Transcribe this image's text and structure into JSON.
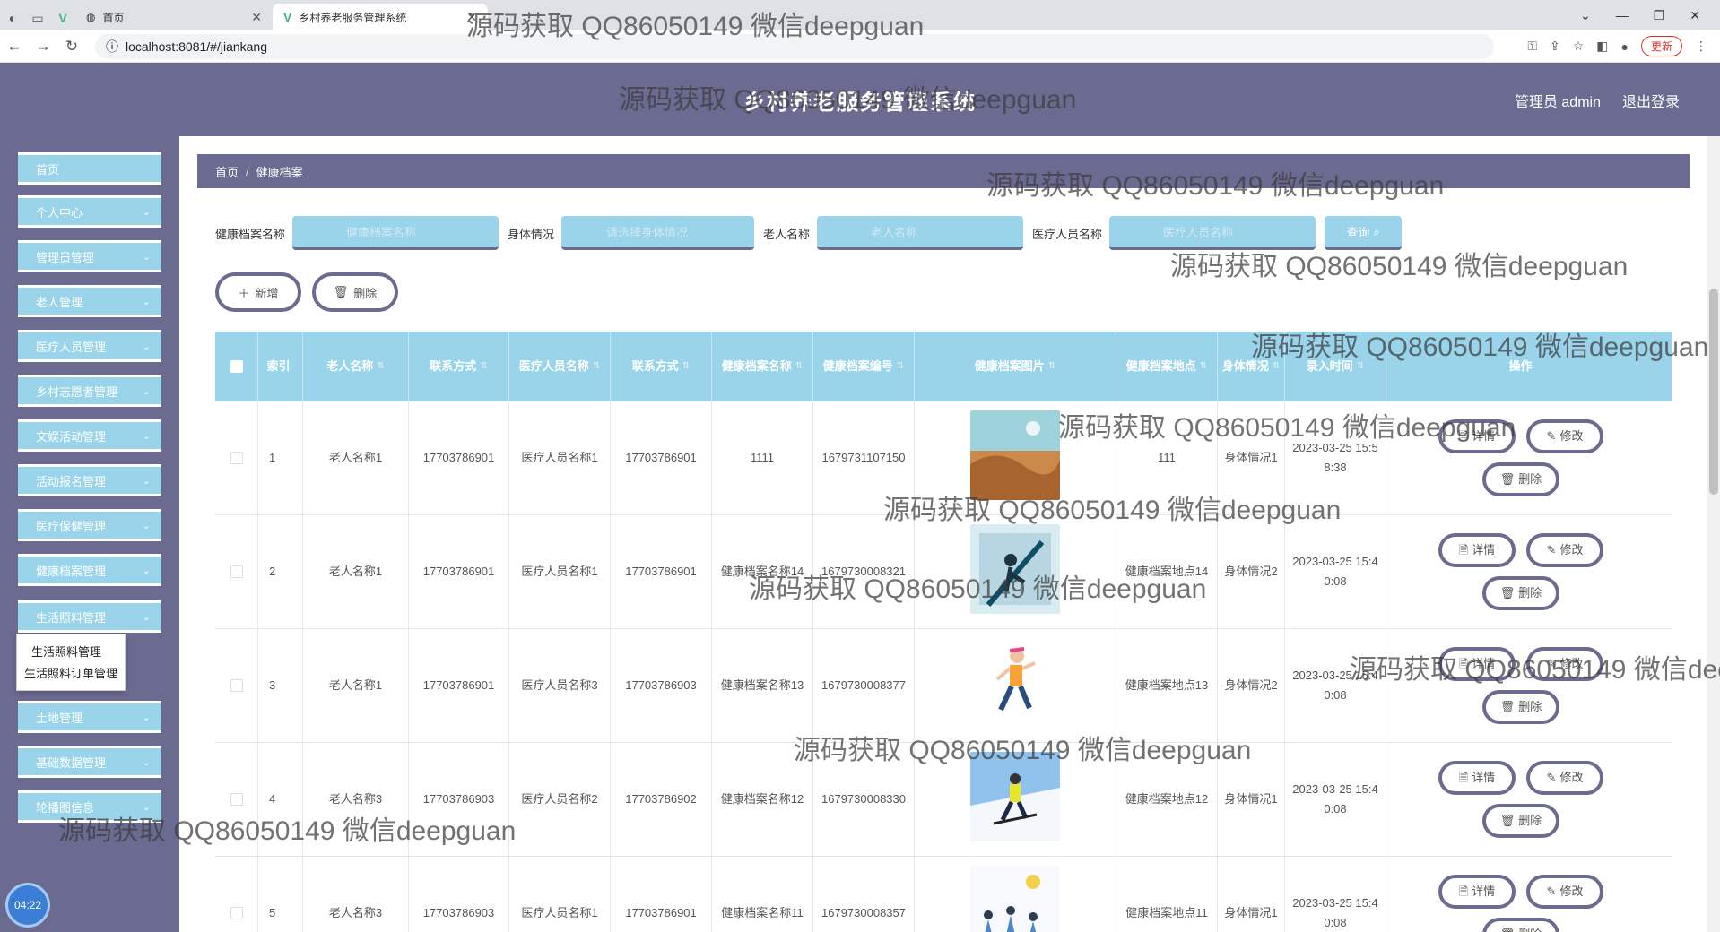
{
  "browser": {
    "tabs": [
      {
        "label": "首页",
        "active": false
      },
      {
        "label": "乡村养老服务管理系统",
        "active": true
      }
    ],
    "url": "localhost:8081/#/jiankang",
    "update_label": "更新"
  },
  "header": {
    "title": "乡村养老服务管理系统",
    "user_label": "管理员 admin",
    "logout_label": "退出登录"
  },
  "sidebar": {
    "items": [
      {
        "label": "首页",
        "expandable": false
      },
      {
        "label": "个人中心",
        "expandable": true
      },
      {
        "label": "管理员管理",
        "expandable": true
      },
      {
        "label": "老人管理",
        "expandable": true
      },
      {
        "label": "医疗人员管理",
        "expandable": true
      },
      {
        "label": "乡村志愿者管理",
        "expandable": true
      },
      {
        "label": "文娱活动管理",
        "expandable": true
      },
      {
        "label": "活动报名管理",
        "expandable": true
      },
      {
        "label": "医疗保健管理",
        "expandable": true
      },
      {
        "label": "健康档案管理",
        "expandable": true
      },
      {
        "label": "生活照料管理",
        "expandable": true
      },
      {
        "label": "土地管理",
        "expandable": true
      },
      {
        "label": "基础数据管理",
        "expandable": true
      },
      {
        "label": "轮播图信息",
        "expandable": true
      }
    ],
    "submenu": [
      "生活照料管理",
      "生活照料订单管理"
    ],
    "timer": "04:22"
  },
  "breadcrumb": {
    "home": "首页",
    "current": "健康档案"
  },
  "search": {
    "fields": [
      {
        "label": "健康档案名称",
        "placeholder": "健康档案名称"
      },
      {
        "label": "身体情况",
        "placeholder": "请选择身体情况"
      },
      {
        "label": "老人名称",
        "placeholder": "老人名称"
      },
      {
        "label": "医疗人员名称",
        "placeholder": "医疗人员名称"
      }
    ],
    "button": "查询"
  },
  "actions": {
    "add": "新增",
    "delete": "删除"
  },
  "table": {
    "headers": [
      "索引",
      "老人名称",
      "联系方式",
      "医疗人员名称",
      "联系方式",
      "健康档案名称",
      "健康档案编号",
      "健康档案图片",
      "健康档案地点",
      "身体情况",
      "录入时间",
      "操作"
    ],
    "rows": [
      {
        "index": "1",
        "elder": "老人名称1",
        "phone1": "17703786901",
        "staff": "医疗人员名称1",
        "phone2": "17703786901",
        "name": "1111",
        "code": "1679731107150",
        "location": "111",
        "status": "身体情况1",
        "time": "2023-03-25 15:58:38",
        "img": "desert"
      },
      {
        "index": "2",
        "elder": "老人名称1",
        "phone1": "17703786901",
        "staff": "医疗人员名称1",
        "phone2": "17703786901",
        "name": "健康档案名称14",
        "code": "1679730008321",
        "location": "健康档案地点14",
        "status": "身体情况2",
        "time": "2023-03-25 15:40:08",
        "img": "treadmill"
      },
      {
        "index": "3",
        "elder": "老人名称1",
        "phone1": "17703786901",
        "staff": "医疗人员名称3",
        "phone2": "17703786903",
        "name": "健康档案名称13",
        "code": "1679730008377",
        "location": "健康档案地点13",
        "status": "身体情况2",
        "time": "2023-03-25 15:40:08",
        "img": "runner"
      },
      {
        "index": "4",
        "elder": "老人名称3",
        "phone1": "17703786903",
        "staff": "医疗人员名称2",
        "phone2": "17703786902",
        "name": "健康档案名称12",
        "code": "1679730008330",
        "location": "健康档案地点12",
        "status": "身体情况1",
        "time": "2023-03-25 15:40:08",
        "img": "skier"
      },
      {
        "index": "5",
        "elder": "老人名称3",
        "phone1": "17703786903",
        "staff": "医疗人员名称1",
        "phone2": "17703786901",
        "name": "健康档案名称11",
        "code": "1679730008357",
        "location": "健康档案地点11",
        "status": "身体情况1",
        "time": "2023-03-25 15:40:08",
        "img": "crowd"
      }
    ],
    "op_labels": {
      "detail": "详情",
      "edit": "修改",
      "delete": "删除"
    }
  },
  "watermark": "源码获取 QQ86050149 微信deepguan",
  "colors": {
    "primary": "#6b6b92",
    "accent": "#9ad4ea"
  }
}
